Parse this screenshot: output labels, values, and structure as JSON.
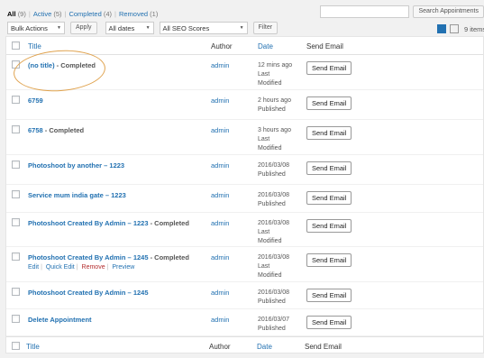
{
  "status_filters": [
    {
      "label": "All",
      "count": "(9)",
      "current": true
    },
    {
      "label": "Active",
      "count": "(5)",
      "current": false
    },
    {
      "label": "Completed",
      "count": "(4)",
      "current": false
    },
    {
      "label": "Removed",
      "count": "(1)",
      "current": false
    }
  ],
  "search": {
    "value": "",
    "placeholder": "",
    "button": "Search Appointments"
  },
  "tablenav": {
    "bulk_actions": "Bulk Actions",
    "apply": "Apply",
    "dates": "All dates",
    "seo": "All SEO Scores",
    "filter": "Filter",
    "items_count": "9 items"
  },
  "columns": {
    "title": "Title",
    "author": "Author",
    "date": "Date",
    "send_email": "Send Email"
  },
  "rows": [
    {
      "title": "(no title)",
      "state": " - Completed",
      "author": "admin",
      "date_line1": "12 mins ago",
      "date_line2": "Last",
      "date_line3": "Modified",
      "button": "Send Email"
    },
    {
      "title": "6759",
      "state": "",
      "author": "admin",
      "date_line1": "2 hours ago",
      "date_line2": "Published",
      "date_line3": "",
      "button": "Send Email"
    },
    {
      "title": "6758",
      "state": " - Completed",
      "author": "admin",
      "date_line1": "3 hours ago",
      "date_line2": "Last",
      "date_line3": "Modified",
      "button": "Send Email"
    },
    {
      "title": "Photoshoot by another – 1223",
      "state": "",
      "author": "admin",
      "date_line1": "2016/03/08",
      "date_line2": "Published",
      "date_line3": "",
      "button": "Send Email"
    },
    {
      "title": "Service mum india gate – 1223",
      "state": "",
      "author": "admin",
      "date_line1": "2016/03/08",
      "date_line2": "Published",
      "date_line3": "",
      "button": "Send Email"
    },
    {
      "title": "Photoshoot Created By Admin – 1223",
      "state": " - Completed",
      "author": "admin",
      "date_line1": "2016/03/08",
      "date_line2": "Last",
      "date_line3": "Modified",
      "button": "Send Email"
    },
    {
      "title": "Photoshoot Created By Admin – 1245",
      "state": " - Completed",
      "author": "admin",
      "date_line1": "2016/03/08",
      "date_line2": "Last",
      "date_line3": "Modified",
      "button": "Send Email",
      "actions": {
        "edit": "Edit",
        "quick_edit": "Quick Edit",
        "remove": "Remove",
        "preview": "Preview"
      }
    },
    {
      "title": "Photoshoot Created By Admin – 1245",
      "state": "",
      "author": "admin",
      "date_line1": "2016/03/08",
      "date_line2": "Published",
      "date_line3": "",
      "button": "Send Email"
    },
    {
      "title": "Delete Appointment",
      "state": "",
      "author": "admin",
      "date_line1": "2016/03/07",
      "date_line2": "Published",
      "date_line3": "",
      "button": "Send Email"
    }
  ],
  "colors": {
    "link": "#2271b1",
    "remove": "#b32d2e",
    "annotation": "#e0a34f"
  }
}
